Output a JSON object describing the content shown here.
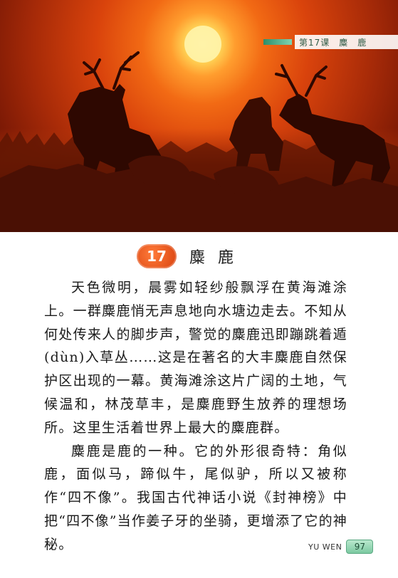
{
  "header": {
    "lesson_label": "第17课　麋　鹿"
  },
  "photo": {
    "subject": "deer-silhouettes-sunset",
    "colors": {
      "sun": "#fff4b0",
      "sky": "#e0520e",
      "dark": "#3a0a02"
    }
  },
  "title": {
    "number": "17",
    "text": "麋鹿"
  },
  "paragraphs": [
    "天色微明，晨雾如轻纱般飘浮在黄海滩涂上。一群麋鹿悄无声息地向水塘边走去。不知从何处传来人的脚步声，警觉的麋鹿迅即蹦跳着遁(dùn)入草丛……这是在著名的大丰麋鹿自然保护区出现的一幕。黄海滩涂这片广阔的土地，气候温和，林茂草丰，是麋鹿野生放养的理想场所。这里生活着世界上最大的麋鹿群。",
    "麋鹿是鹿的一种。它的外形很奇特：角似鹿，面似马，蹄似牛，尾似驴，所以又被称作“四不像”。我国古代神话小说《封神榜》中把“四不像”当作姜子牙的坐骑，更增添了它的神秘。"
  ],
  "footer": {
    "book": "YU WEN",
    "page": "97"
  }
}
